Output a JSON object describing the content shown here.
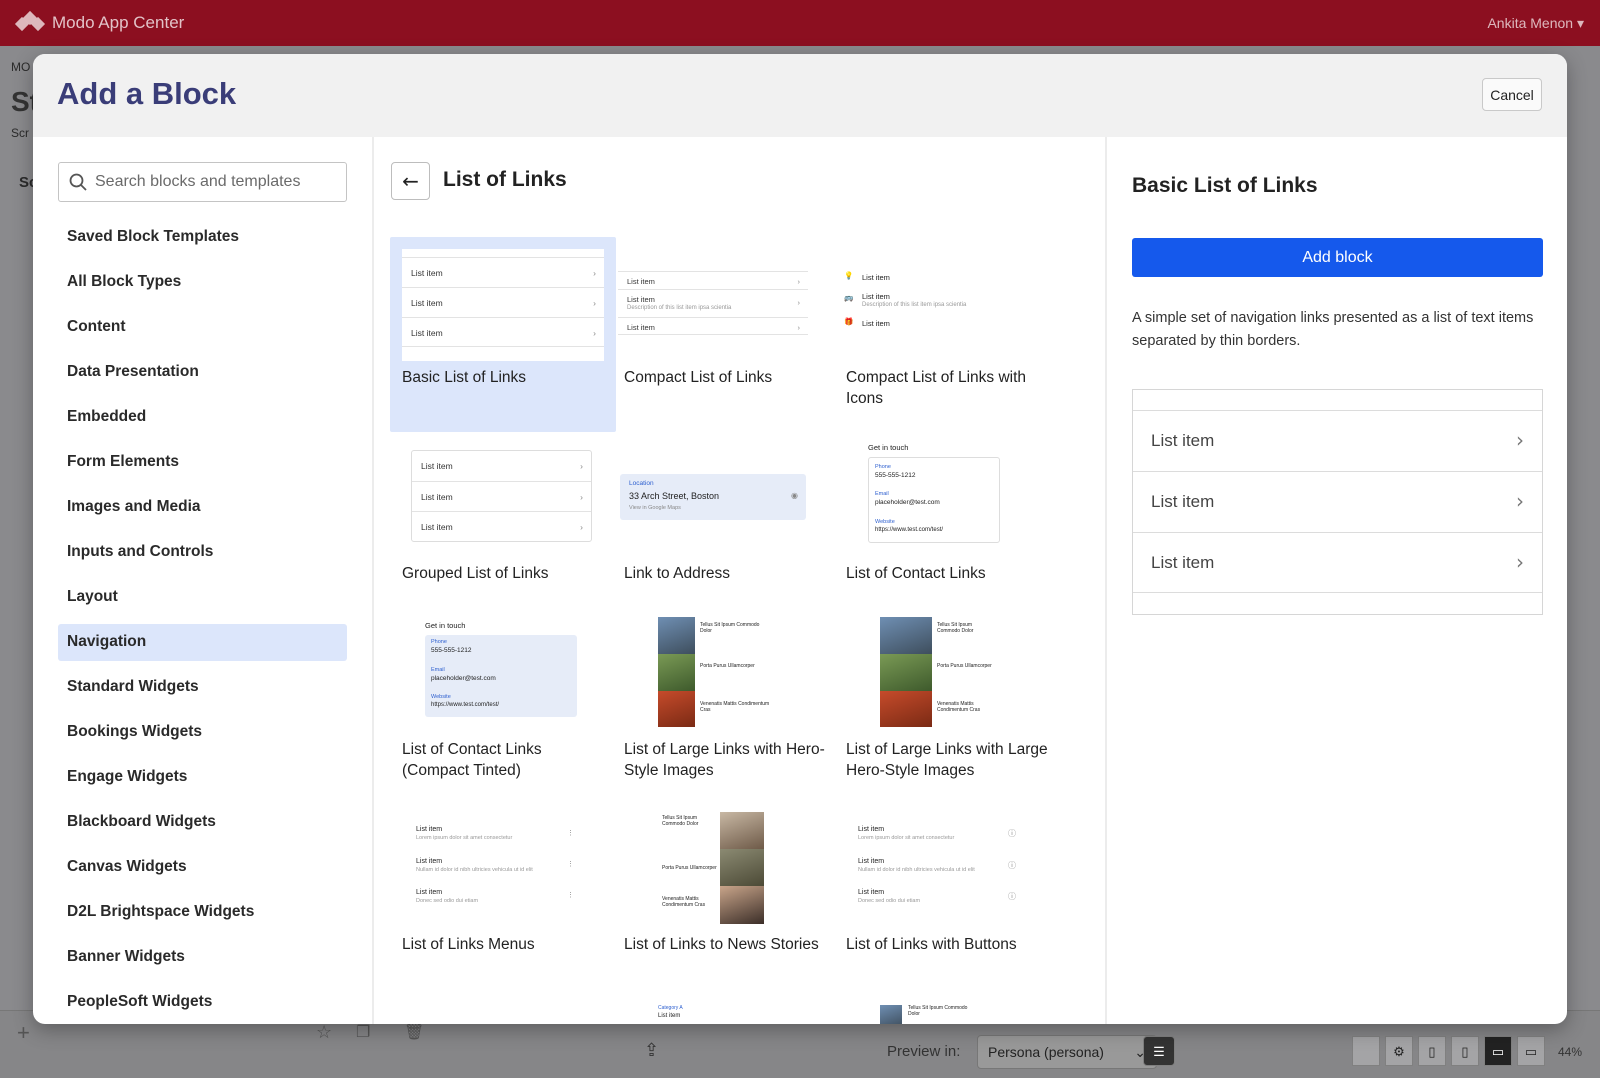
{
  "app": {
    "name": "Modo App Center",
    "user": "Ankita Menon"
  },
  "background": {
    "frag1": "MO",
    "frag2": "St",
    "frag3": "Scr",
    "frag4": "Sc"
  },
  "bottom": {
    "preview_label": "Preview in:",
    "preview_value": "Persona (persona)",
    "zoom": "44%"
  },
  "modal": {
    "title": "Add a Block",
    "cancel": "Cancel",
    "search_placeholder": "Search blocks and templates",
    "categories": [
      "Saved Block Templates",
      "All Block Types",
      "Content",
      "Data Presentation",
      "Embedded",
      "Form Elements",
      "Images and Media",
      "Inputs and Controls",
      "Layout",
      "Navigation",
      "Standard Widgets",
      "Bookings Widgets",
      "Engage Widgets",
      "Blackboard Widgets",
      "Canvas Widgets",
      "D2L Brightspace Widgets",
      "Banner Widgets",
      "PeopleSoft Widgets"
    ],
    "active_category": "Navigation",
    "section_title": "List of Links",
    "cards": [
      "Basic List of Links",
      "Compact List of Links",
      "Compact List of Links with Icons",
      "Grouped List of Links",
      "Link to Address",
      "List of Contact Links",
      "List of Contact Links (Compact Tinted)",
      "List of Large Links with Hero-Style Images",
      "List of Large Links with Large Hero-Style Images",
      "List of Links Menus",
      "List of Links to News Stories",
      "List of Links with Buttons"
    ],
    "thumb": {
      "list_item": "List item",
      "desc": "Description of this list item ipsa scientia",
      "location": "Location",
      "address": "33 Arch Street, Boston",
      "maps": "View in Google Maps",
      "get_in_touch": "Get in touch",
      "phone_label": "Phone",
      "phone": "555-555-1212",
      "email_label": "Email",
      "email": "placeholder@test.com",
      "website_label": "Website",
      "website": "https://www.test.com/test/",
      "lorem1": "Lorem ipsum dolor sit amet consectetur",
      "lorem2": "Nullam id dolor id nibh ultricies vehicula ut id elit",
      "lorem3": "Donec sed odio dui etiam",
      "hero1": "Tellus Sit Ipsum Commodo Dolor",
      "hero2": "Porta Purus Ullamcorper",
      "hero3": "Venenatis Mattis Condimentum Cras",
      "category": "Category A"
    },
    "detail": {
      "title": "Basic List of Links",
      "add": "Add block",
      "description": "A simple set of navigation links presented as a list of text items separated by thin borders.",
      "preview_items": [
        "List item",
        "List item",
        "List item"
      ]
    }
  },
  "colors": {
    "topbar": "#8c0f20",
    "title": "#3a3d78",
    "primary": "#1559ec",
    "selected": "#dce6fb"
  }
}
